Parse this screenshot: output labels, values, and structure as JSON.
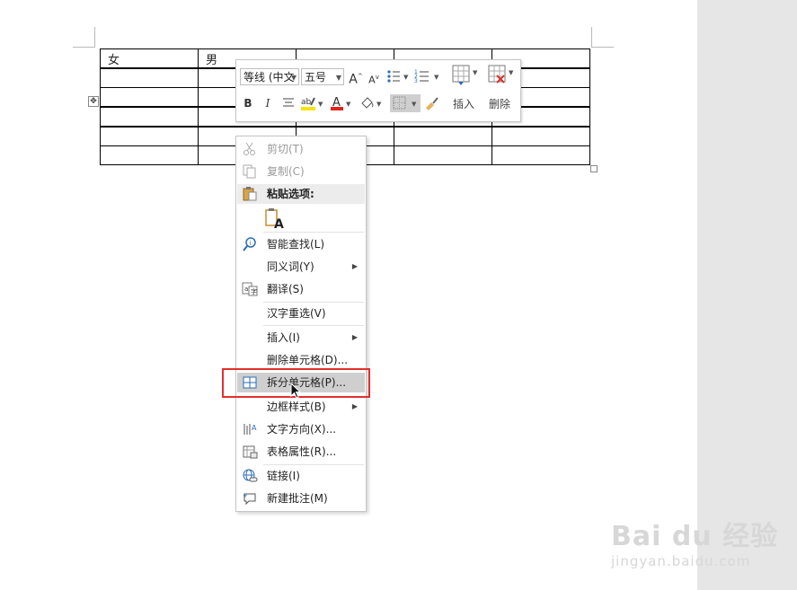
{
  "table": {
    "rows": [
      [
        "女",
        "男",
        "",
        "",
        ""
      ],
      [
        "",
        "",
        "",
        "",
        ""
      ],
      [
        "",
        "",
        "",
        "",
        ""
      ],
      [
        "",
        "",
        "",
        "",
        ""
      ],
      [
        "",
        "",
        "",
        "",
        ""
      ],
      [
        "",
        "",
        "",
        "",
        ""
      ]
    ],
    "move_handle": "✥"
  },
  "mini_toolbar": {
    "font_name": "等线 (中文",
    "font_size": "五号",
    "grow_font": "A",
    "shrink_font": "A",
    "bold": "B",
    "italic": "I",
    "font_color_letter": "A",
    "highlight_color": "#f5e400",
    "font_color": "#e0241b",
    "insert_label": "插入",
    "delete_label": "删除"
  },
  "context_menu": {
    "cut": "剪切(T)",
    "copy": "复制(C)",
    "paste_options": "粘贴选项:",
    "smart_lookup": "智能查找(L)",
    "synonyms": "同义词(Y)",
    "translate": "翻译(S)",
    "reconvert": "汉字重选(V)",
    "insert": "插入(I)",
    "delete_cells": "删除单元格(D)...",
    "split_cells": "拆分单元格(P)...",
    "border_styles": "边框样式(B)",
    "text_direction": "文字方向(X)...",
    "table_properties": "表格属性(R)...",
    "link": "链接(I)",
    "new_comment": "新建批注(M)"
  },
  "watermark": {
    "logo": "Bai du 经验",
    "url": "jingyan.baidu.com"
  },
  "colors": {
    "highlight_border": "#e1302e",
    "selected_item_bg": "#cfcfcf",
    "gutter": "#e6e6e6"
  }
}
